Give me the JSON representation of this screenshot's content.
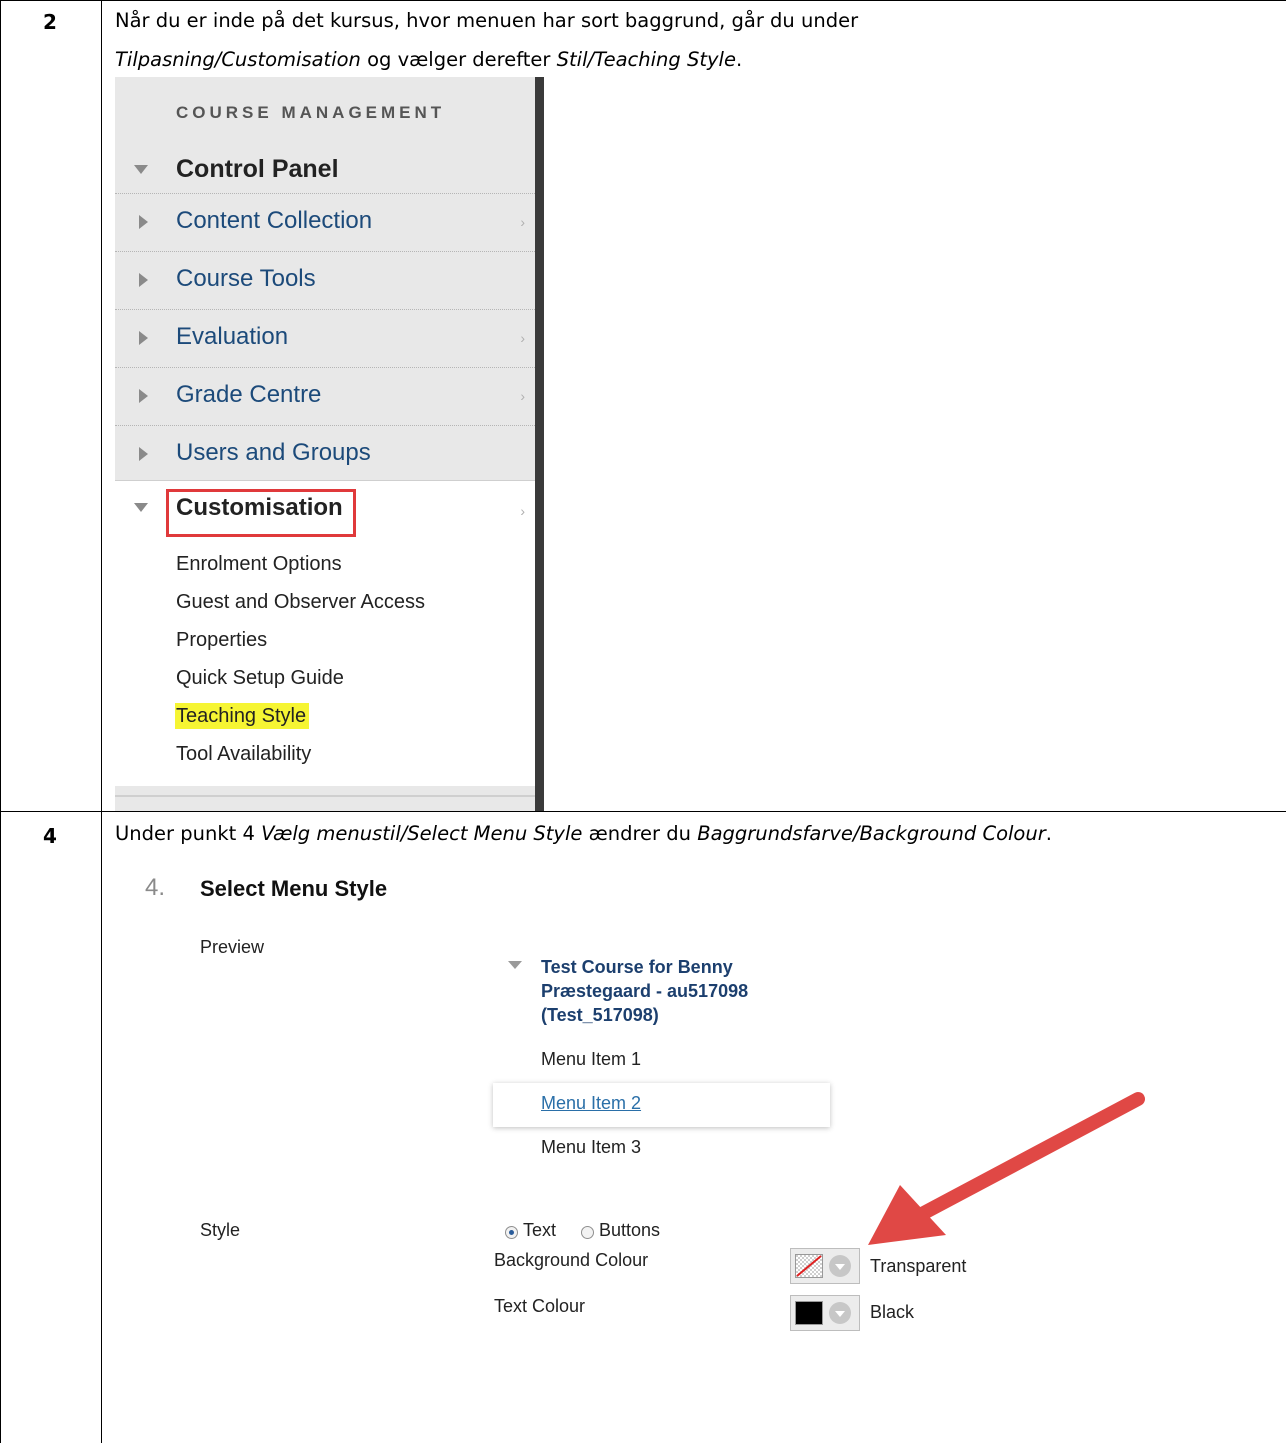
{
  "steps": [
    {
      "number": "2",
      "text_line1": "Når du er inde på det kursus, hvor menuen har sort baggrund, går du under",
      "text_line2_italic1": "Tilpasning/Customisation",
      "text_line2_mid": " og vælger derefter ",
      "text_line2_italic2": "Stil/Teaching Style",
      "text_line2_end": "."
    },
    {
      "number": "4",
      "text_pre": "Under punkt 4 ",
      "text_italic1": "Vælg menustil/Select Menu Style",
      "text_mid": " ændrer du ",
      "text_italic2": "Baggrundsfarve/Background Colour",
      "text_end": "."
    }
  ],
  "course_menu": {
    "heading": "COURSE MANAGEMENT",
    "control_panel": "Control Panel",
    "items": [
      {
        "label": "Content Collection",
        "chevron": "›"
      },
      {
        "label": "Course Tools",
        "chevron": ""
      },
      {
        "label": "Evaluation",
        "chevron": "›"
      },
      {
        "label": "Grade Centre",
        "chevron": "›"
      },
      {
        "label": "Users and Groups",
        "chevron": ""
      }
    ],
    "customisation": {
      "label": "Customisation",
      "chevron": "›",
      "sub_items": [
        "Enrolment Options",
        "Guest and Observer Access",
        "Properties",
        "Quick Setup Guide",
        "Teaching Style",
        "Tool Availability"
      ],
      "highlighted_item": "Teaching Style"
    }
  },
  "menu_style": {
    "number": "4.",
    "title": "Select Menu Style",
    "preview_label": "Preview",
    "course_name_line1": "Test Course for Benny",
    "course_name_line2": "Præstegaard - au517098",
    "course_name_line3": "(Test_517098)",
    "menu_items": [
      "Menu Item 1",
      "Menu Item 2",
      "Menu Item 3"
    ],
    "style_label": "Style",
    "radio_text": "Text",
    "radio_buttons": "Buttons",
    "selected_style": "Text",
    "background_colour_label": "Background Colour",
    "background_colour_value": "Transparent",
    "text_colour_label": "Text Colour",
    "text_colour_value": "Black"
  },
  "colors": {
    "highlight": "#f6f533",
    "red_frame": "#e0393b",
    "arrow": "#e04845",
    "link_blue": "#2a6fa8"
  }
}
